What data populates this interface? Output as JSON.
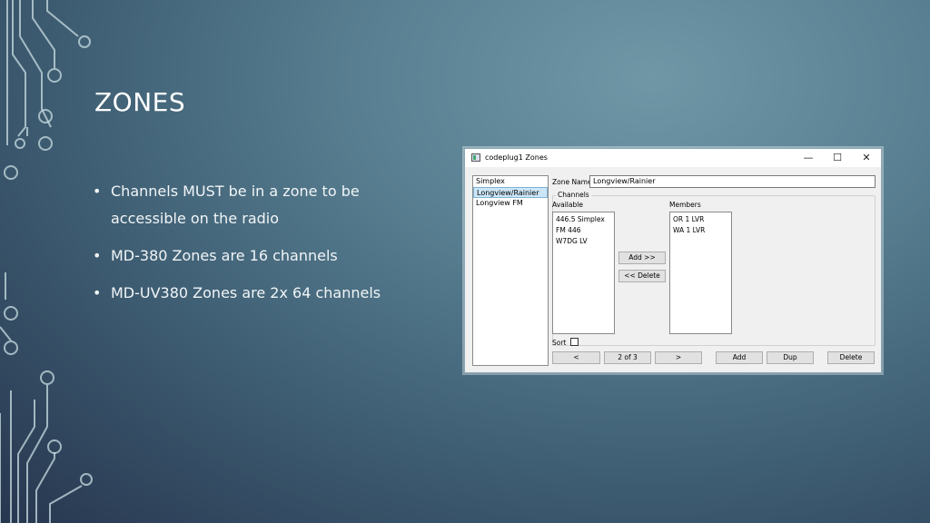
{
  "slide": {
    "title": "ZONES",
    "bullets": [
      "Channels MUST be in a zone to be accessible on the radio",
      "MD-380 Zones are 16 channels",
      "MD-UV380 Zones are 2x 64 channels"
    ],
    "bullet_glyph": "•"
  },
  "dialog": {
    "title": "codeplug1 Zones",
    "controls": {
      "minimize": "—",
      "maximize": "☐",
      "close": "✕"
    },
    "zones": [
      "Simplex",
      "Longview/Rainier",
      "Longview FM"
    ],
    "selected_zone": "Longview/Rainier",
    "zone_name_label": "Zone Name",
    "zone_name_value": "Longview/Rainier",
    "channels_group": "Channels",
    "available_label": "Available",
    "available": [
      "446.5 Simplex",
      "FM 446",
      "W7DG LV"
    ],
    "members_label": "Members",
    "members": [
      "OR 1 LVR",
      "WA 1 LVR"
    ],
    "add_member_button": "Add >>",
    "delete_member_button": "<< Delete",
    "sort_label": "Sort",
    "sort_checked": false,
    "prev_button": "<",
    "page_indicator": "2 of 3",
    "next_button": ">",
    "add_button": "Add",
    "dup_button": "Dup",
    "delete_button": "Delete"
  },
  "colors": {
    "background_light": "#6f97a6",
    "background_dark": "#27364f",
    "selection": "#cce6f7"
  }
}
